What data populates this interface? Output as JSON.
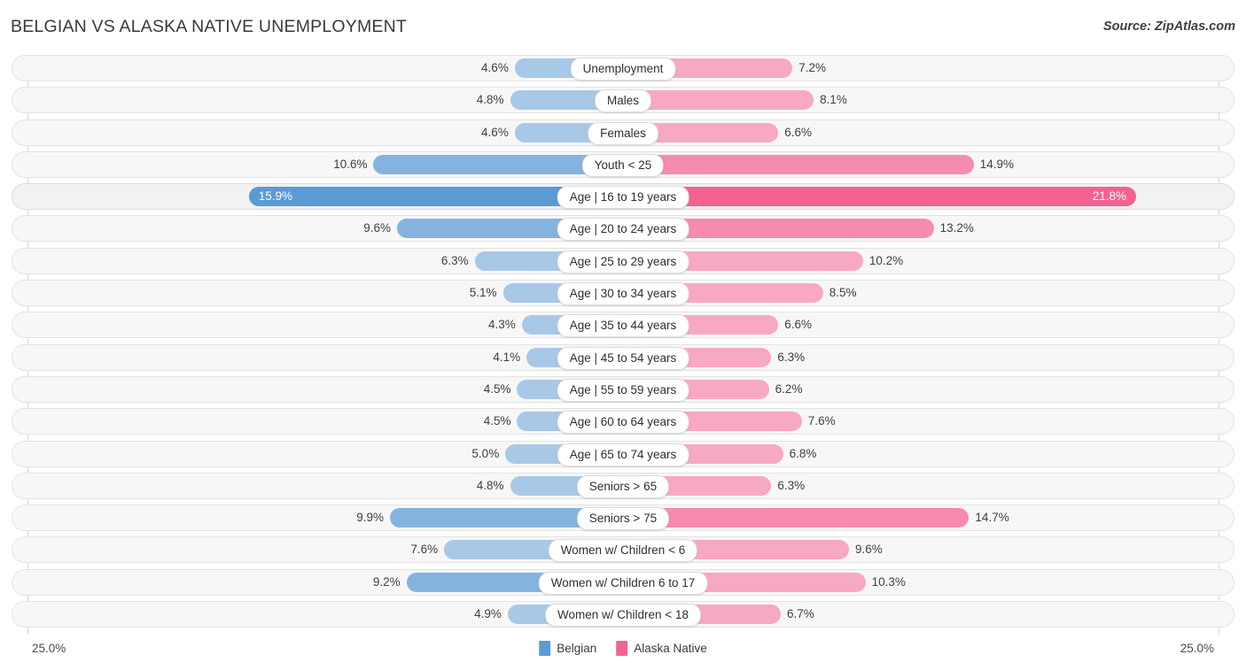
{
  "header": {
    "title": "BELGIAN VS ALASKA NATIVE UNEMPLOYMENT",
    "source": "Source: ZipAtlas.com"
  },
  "axis": {
    "left_end": "25.0%",
    "right_end": "25.0%",
    "max": 25.0
  },
  "legend": {
    "items": [
      {
        "label": "Belgian",
        "color": "#5b9bd5"
      },
      {
        "label": "Alaska Native",
        "color": "#f4628f"
      }
    ]
  },
  "colors": {
    "left_light": "#a8c8e8",
    "left_mid": "#85b3e0",
    "left_strong": "#5b9bd5",
    "right_light": "#f7a8c4",
    "right_mid": "#f58bb0",
    "right_strong": "#f4628f",
    "row_bg": "#f7f7f7",
    "row_border": "#e3e3e3"
  },
  "chart_data": {
    "type": "bar",
    "title": "BELGIAN VS ALASKA NATIVE UNEMPLOYMENT",
    "subtitle": "",
    "orientation": "horizontal-diverging",
    "xlabel": "",
    "ylabel": "",
    "xlim": [
      25.0,
      25.0
    ],
    "grid": false,
    "legend_position": "bottom-center",
    "categories": [
      "Unemployment",
      "Males",
      "Females",
      "Youth < 25",
      "Age | 16 to 19 years",
      "Age | 20 to 24 years",
      "Age | 25 to 29 years",
      "Age | 30 to 34 years",
      "Age | 35 to 44 years",
      "Age | 45 to 54 years",
      "Age | 55 to 59 years",
      "Age | 60 to 64 years",
      "Age | 65 to 74 years",
      "Seniors > 65",
      "Seniors > 75",
      "Women w/ Children < 6",
      "Women w/ Children 6 to 17",
      "Women w/ Children < 18"
    ],
    "series": [
      {
        "name": "Belgian",
        "values": [
          4.6,
          4.8,
          4.6,
          10.6,
          15.9,
          9.6,
          6.3,
          5.1,
          4.3,
          4.1,
          4.5,
          4.5,
          5.0,
          4.8,
          9.9,
          7.6,
          9.2,
          4.9
        ],
        "labels": [
          "4.6%",
          "4.8%",
          "4.6%",
          "10.6%",
          "15.9%",
          "9.6%",
          "6.3%",
          "5.1%",
          "4.3%",
          "4.1%",
          "4.5%",
          "4.5%",
          "5.0%",
          "4.8%",
          "9.9%",
          "7.6%",
          "9.2%",
          "4.9%"
        ]
      },
      {
        "name": "Alaska Native",
        "values": [
          7.2,
          8.1,
          6.6,
          14.9,
          21.8,
          13.2,
          10.2,
          8.5,
          6.6,
          6.3,
          6.2,
          7.6,
          6.8,
          6.3,
          14.7,
          9.6,
          10.3,
          6.7
        ],
        "labels": [
          "7.2%",
          "8.1%",
          "6.6%",
          "14.9%",
          "21.8%",
          "13.2%",
          "10.2%",
          "8.5%",
          "6.6%",
          "6.3%",
          "6.2%",
          "7.6%",
          "6.8%",
          "6.3%",
          "14.7%",
          "9.6%",
          "10.3%",
          "6.7%"
        ]
      }
    ],
    "highlighted_row": "Age | 16 to 19 years"
  }
}
